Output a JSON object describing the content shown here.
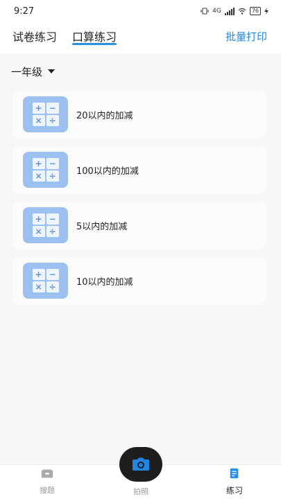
{
  "status": {
    "time": "9:27",
    "network": "4G",
    "battery": "76"
  },
  "header": {
    "tabs": [
      {
        "label": "试卷练习",
        "active": false
      },
      {
        "label": "口算练习",
        "active": true
      }
    ],
    "action_label": "批量打印",
    "accent_color": "#1f87e3"
  },
  "grade": {
    "selected": "一年级"
  },
  "items": [
    {
      "title": "20以内的加减",
      "icon": "math-operators-icon"
    },
    {
      "title": "100以内的加减",
      "icon": "math-operators-icon"
    },
    {
      "title": "5以内的加减",
      "icon": "math-operators-icon"
    },
    {
      "title": "10以内的加减",
      "icon": "math-operators-icon"
    }
  ],
  "math_symbols": [
    "+",
    "−",
    "×",
    "÷"
  ],
  "tabbar": {
    "search_label": "搜题",
    "photo_label": "拍照",
    "practice_label": "练习"
  }
}
